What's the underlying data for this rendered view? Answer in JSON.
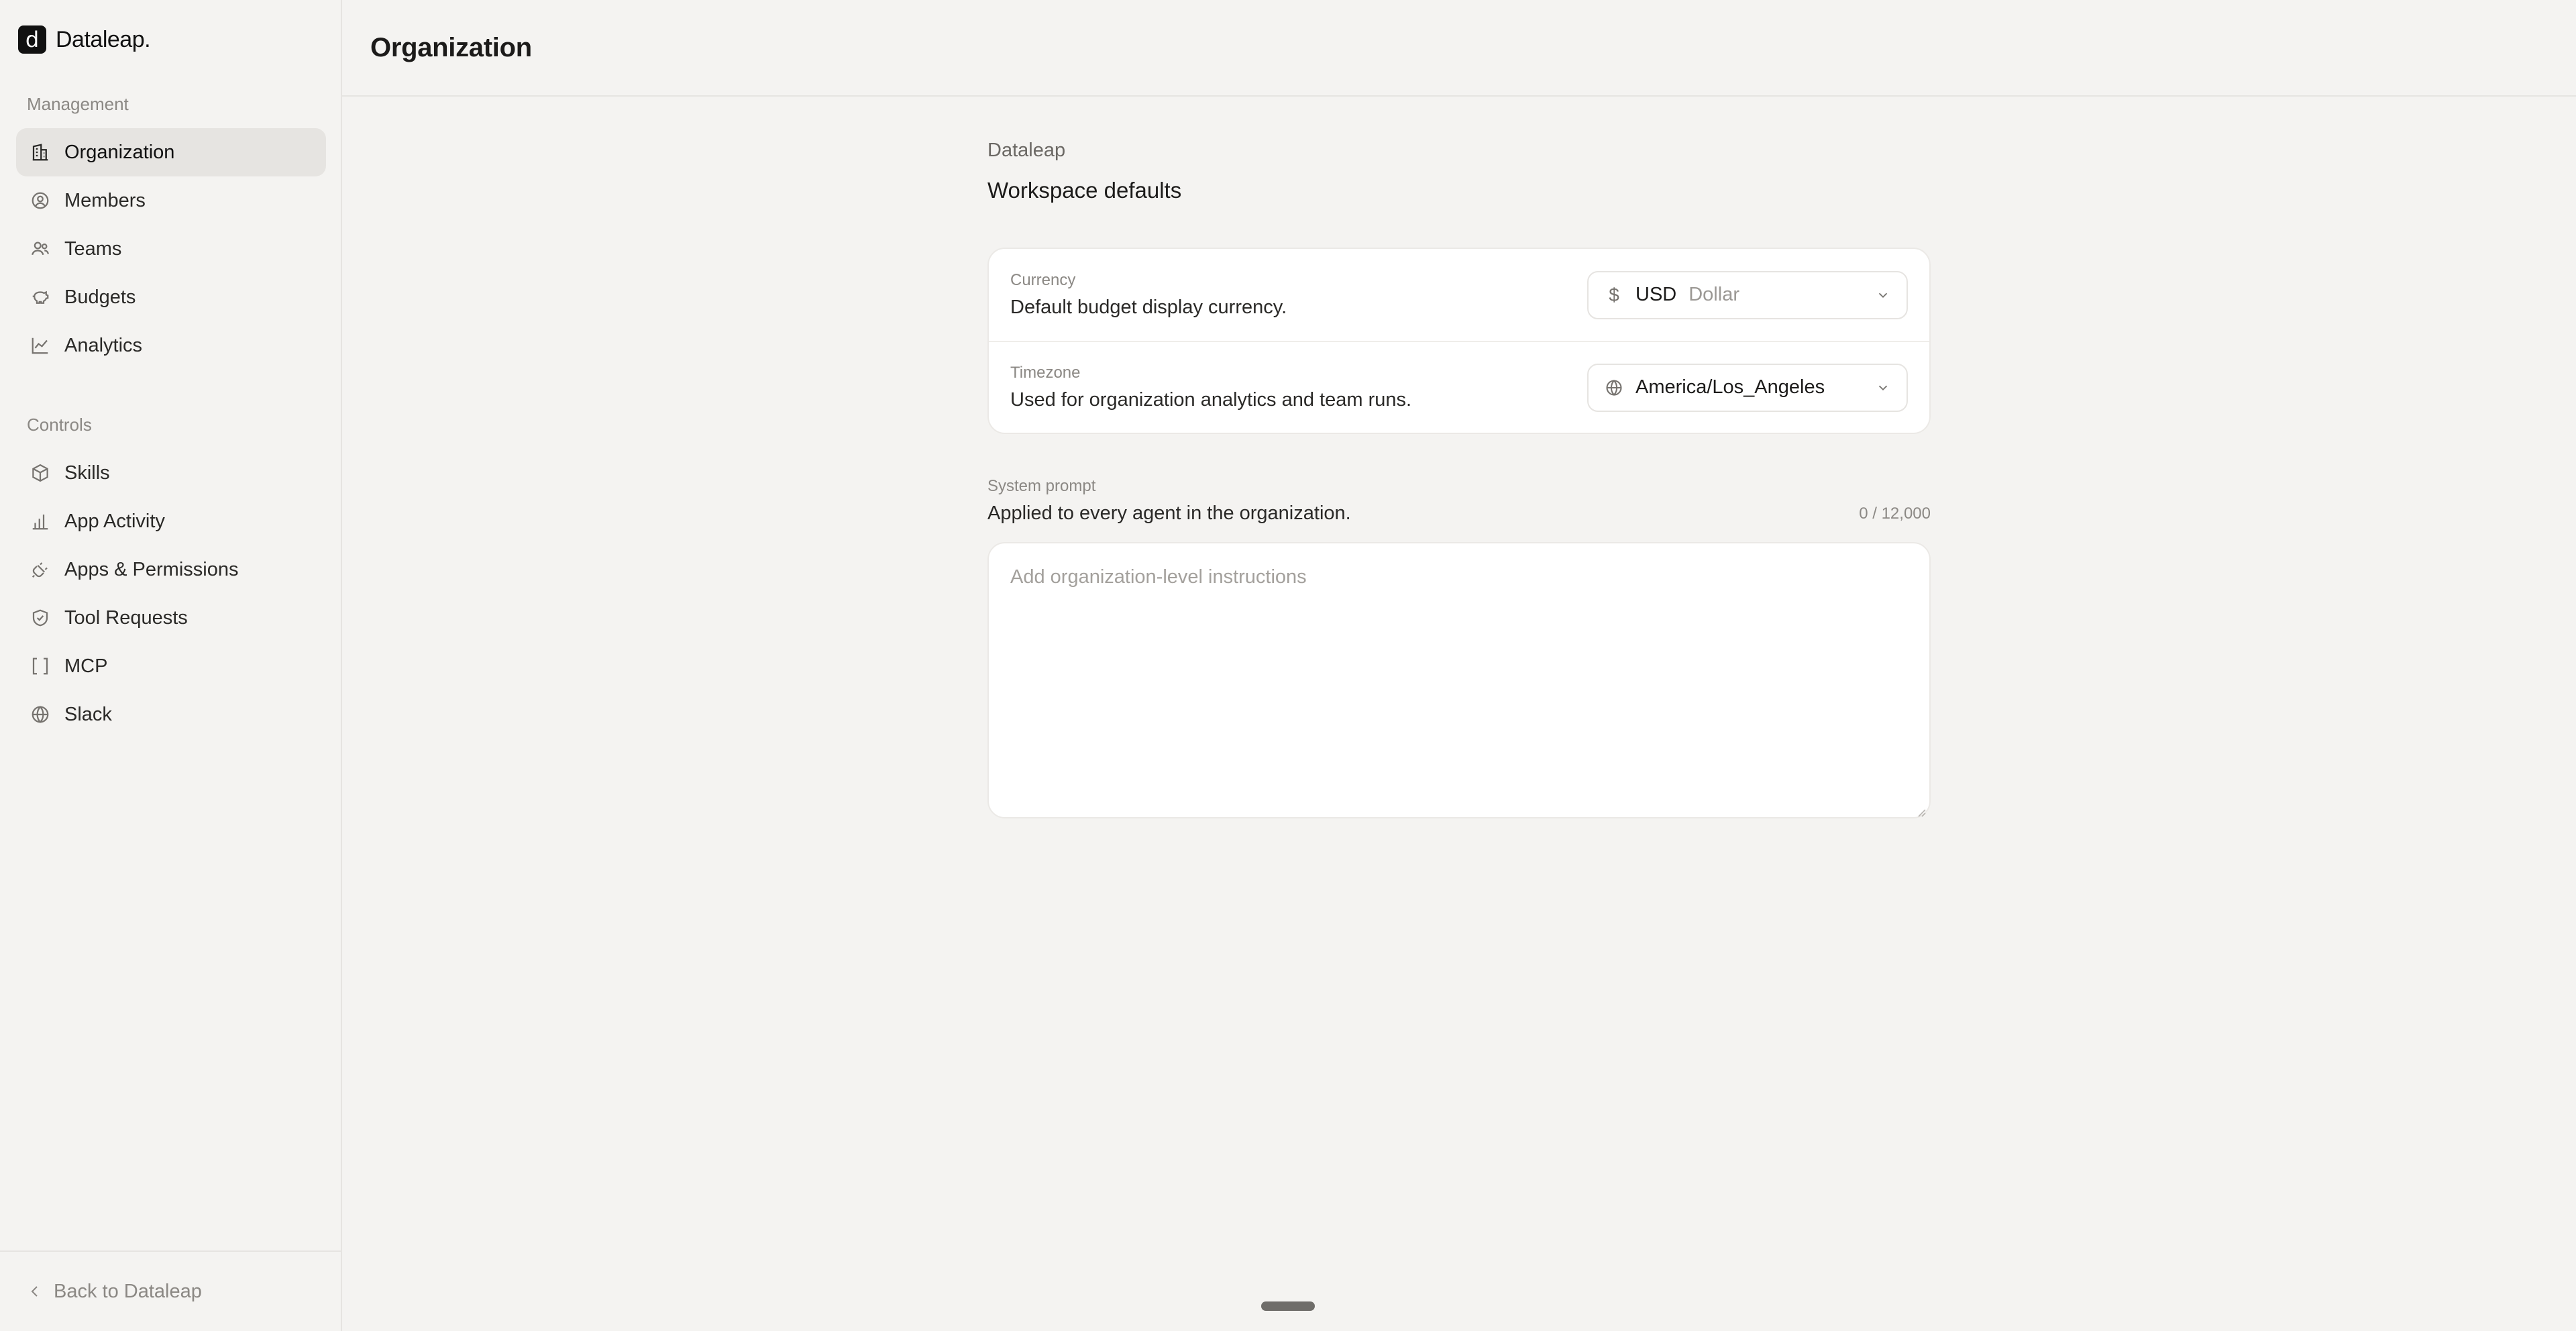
{
  "brand": {
    "name": "Dataleap.",
    "mark": "d"
  },
  "sidebar": {
    "management_label": "Management",
    "management_items": [
      {
        "label": "Organization",
        "icon": "building-icon",
        "active": true
      },
      {
        "label": "Members",
        "icon": "user-circle-icon"
      },
      {
        "label": "Teams",
        "icon": "users-icon"
      },
      {
        "label": "Budgets",
        "icon": "piggy-bank-icon"
      },
      {
        "label": "Analytics",
        "icon": "line-chart-icon"
      }
    ],
    "controls_label": "Controls",
    "controls_items": [
      {
        "label": "Skills",
        "icon": "cube-icon"
      },
      {
        "label": "App Activity",
        "icon": "bar-chart-icon"
      },
      {
        "label": "Apps & Permissions",
        "icon": "plug-icon"
      },
      {
        "label": "Tool Requests",
        "icon": "shield-check-icon"
      },
      {
        "label": "MCP",
        "icon": "brackets-icon"
      },
      {
        "label": "Slack",
        "icon": "globe-icon"
      }
    ],
    "footer_label": "Back to Dataleap"
  },
  "header": {
    "title": "Organization"
  },
  "main": {
    "org_name": "Dataleap",
    "section_title": "Workspace defaults",
    "currency": {
      "label": "Currency",
      "description": "Default budget display currency.",
      "symbol": "$",
      "code": "USD",
      "name": "Dollar"
    },
    "timezone": {
      "label": "Timezone",
      "description": "Used for organization analytics and team runs.",
      "value": "America/Los_Angeles"
    },
    "system_prompt": {
      "label": "System prompt",
      "description": "Applied to every agent in the organization.",
      "counter": "0 / 12,000",
      "placeholder": "Add organization-level instructions",
      "value": ""
    }
  }
}
